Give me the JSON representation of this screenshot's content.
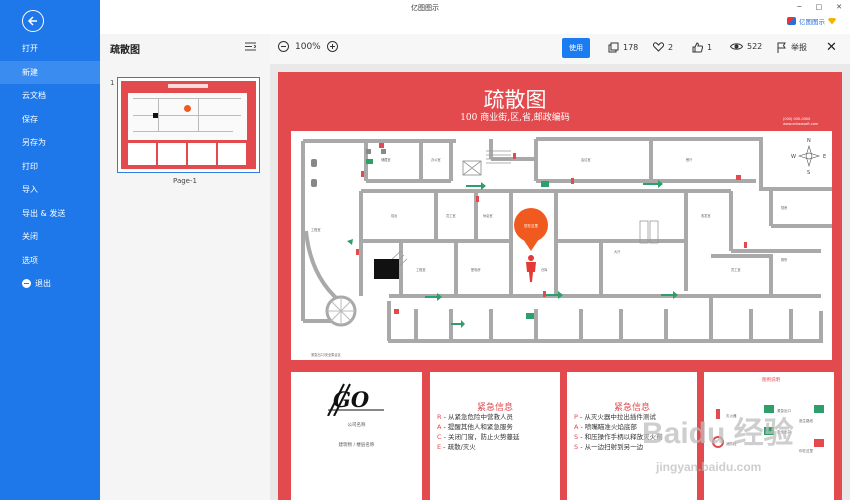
{
  "window": {
    "title": "亿图图示",
    "brand": "亿图图示",
    "controls": [
      "─",
      "□",
      "✕"
    ]
  },
  "sidebar": {
    "items": [
      {
        "label": "打开"
      },
      {
        "label": "新建"
      },
      {
        "label": "云文档"
      },
      {
        "label": "保存"
      },
      {
        "label": "另存为"
      },
      {
        "label": "打印"
      },
      {
        "label": "导入"
      },
      {
        "label": "导出 & 发送"
      },
      {
        "label": "关闭"
      },
      {
        "label": "选项"
      },
      {
        "label": "退出"
      }
    ]
  },
  "thumbnails": {
    "title": "疏散图",
    "page_number": "1",
    "page_label": "Page-1"
  },
  "toolbar": {
    "zoom": "100%",
    "use_label": "使用",
    "copies": "178",
    "likes": "2",
    "thumbs": "1",
    "views": "522",
    "report": "举报",
    "close": "✕"
  },
  "sheet": {
    "title": "疏散图",
    "subtitle": "100 商业街,区,省,邮政编码",
    "contact_lines": [
      "(000) 000-0000",
      "www.edrawsoft.com"
    ],
    "compass": [
      "N",
      "S",
      "W",
      "E"
    ],
    "note": "紧急出口/安全集合区",
    "rooms": [
      "储藏室",
      "办公室",
      "会议室",
      "餐厅",
      "前台",
      "员工室",
      "休息室",
      "厕所",
      "工程室",
      "配电房",
      "仓库",
      "收发室",
      "厨房",
      "大厅"
    ],
    "legend_title": "图例说明",
    "colors": {
      "sheet": "#e24a4e",
      "map_walls": "#a9a9a9",
      "arrow": "#2e9e6a",
      "pin": "#f05a1f"
    }
  },
  "cards": {
    "logo": {
      "mark": "GO",
      "lines": [
        "公司名称",
        "建筑物 / 楼层名称"
      ]
    },
    "info1": {
      "heading": "紧急信息",
      "lines": [
        {
          "k": "R",
          "t": " - 从紧急危险中营救人员"
        },
        {
          "k": "A",
          "t": " - 提醒其他人和紧急服务"
        },
        {
          "k": "C",
          "t": " - 关闭门窗，防止火势蔓延"
        },
        {
          "k": "E",
          "t": " - 疏散/灭火"
        }
      ]
    },
    "info2": {
      "heading": "紧急信息",
      "lines": [
        {
          "k": "P",
          "t": " - 从灭火器中拉出插件测试"
        },
        {
          "k": "A",
          "t": " - 喷嘴瞄准火焰底部"
        },
        {
          "k": "S",
          "t": " - 和压操作手柄以释放灭火剂"
        },
        {
          "k": "S",
          "t": " - 从一边扫射到另一边"
        }
      ]
    },
    "legend": {
      "heading": "图例说明",
      "items": [
        "紧急出口",
        "灭火器",
        "安全出口",
        "逃生路线",
        "你在这里",
        "消防栓"
      ]
    }
  },
  "watermark": {
    "main": "Baidu 经验",
    "sub": "jingyan.baidu.com"
  }
}
